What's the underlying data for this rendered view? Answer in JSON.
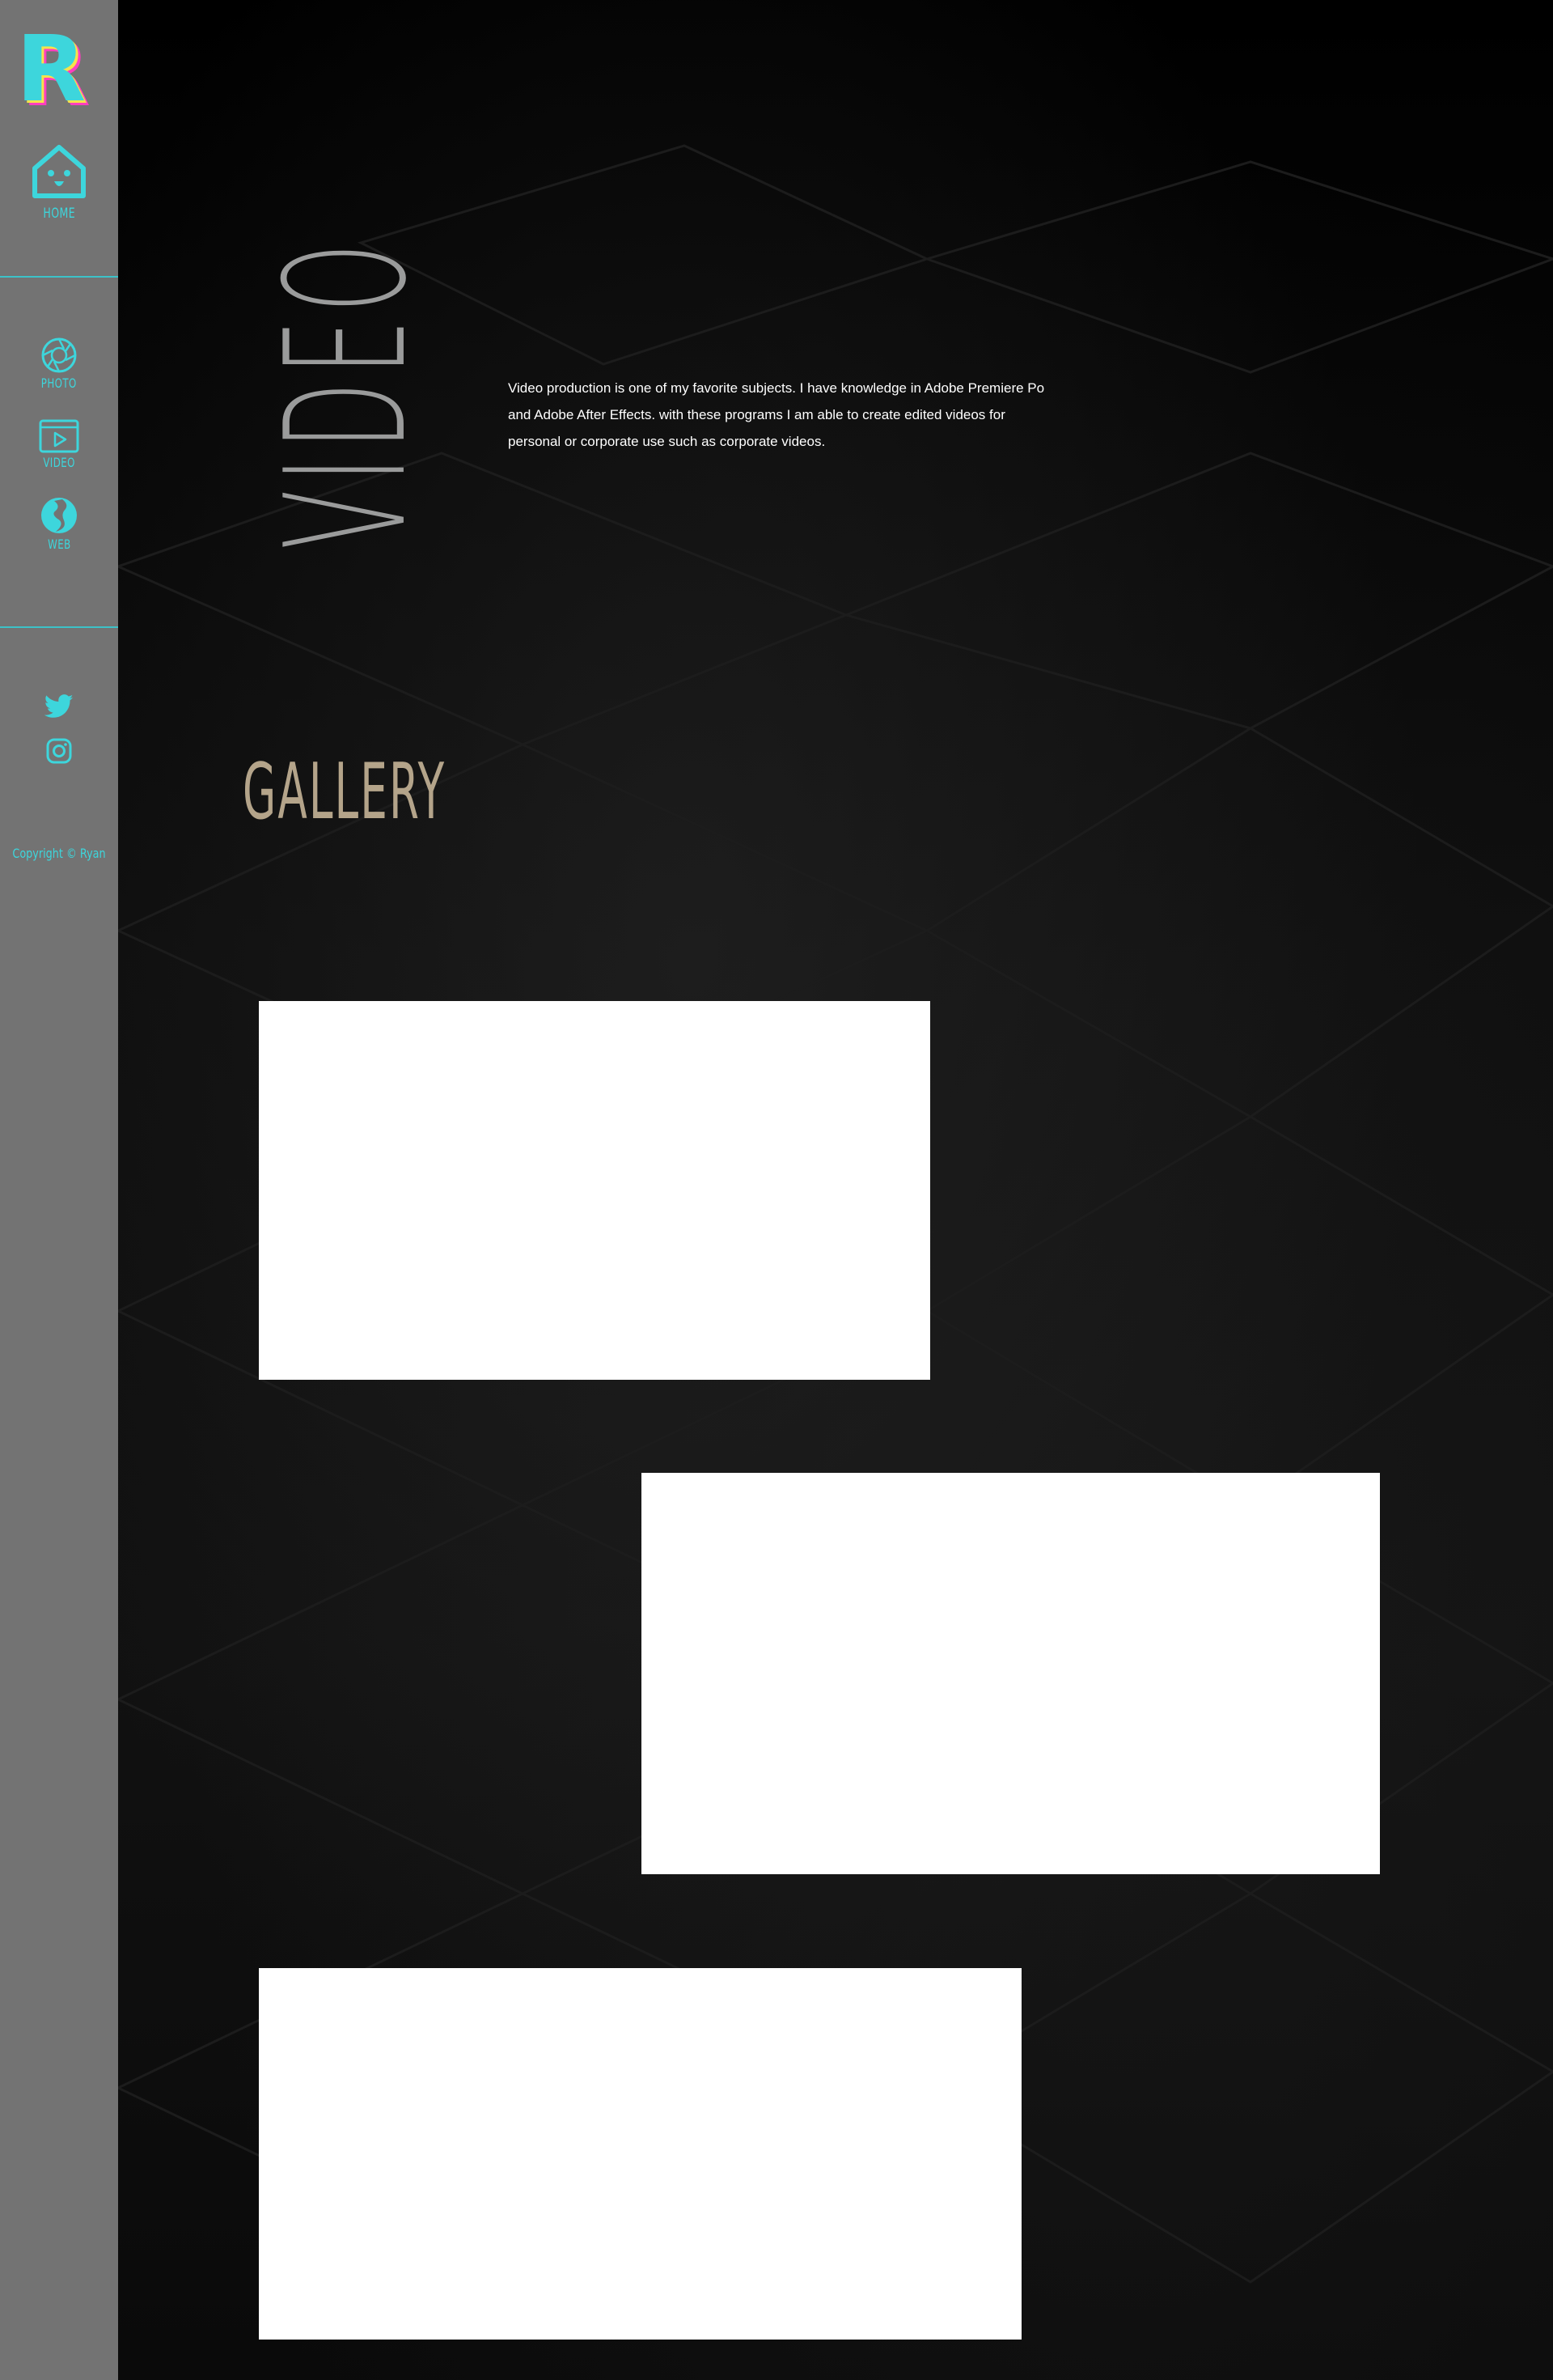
{
  "sidebar": {
    "logo_letter": "R",
    "home_label": "HOME",
    "nav": [
      {
        "label": "PHOTO",
        "icon": "camera-aperture-icon"
      },
      {
        "label": "VIDEO",
        "icon": "video-play-icon"
      },
      {
        "label": "WEB",
        "icon": "globe-icon"
      }
    ],
    "social": [
      {
        "icon": "twitter-icon"
      },
      {
        "icon": "instagram-icon"
      }
    ],
    "copyright": "Copyright © Ryan"
  },
  "hero": {
    "title": "VIDEO",
    "description": "Video production is one of my favorite subjects. I have knowledge in Adobe Premiere Po and Adobe After Effects. with these programs I am able to create edited videos for personal or corporate use such as corporate videos."
  },
  "gallery": {
    "title": "GALLERY",
    "item_count": 3
  },
  "colors": {
    "accent": "#3dd6dc",
    "sidebar_bg": "#737373",
    "gallery_title": "#b4a48a",
    "video_title": "#9a9b9b",
    "logo_pink": "#ff3ec0",
    "logo_yellow": "#f6e34a"
  }
}
